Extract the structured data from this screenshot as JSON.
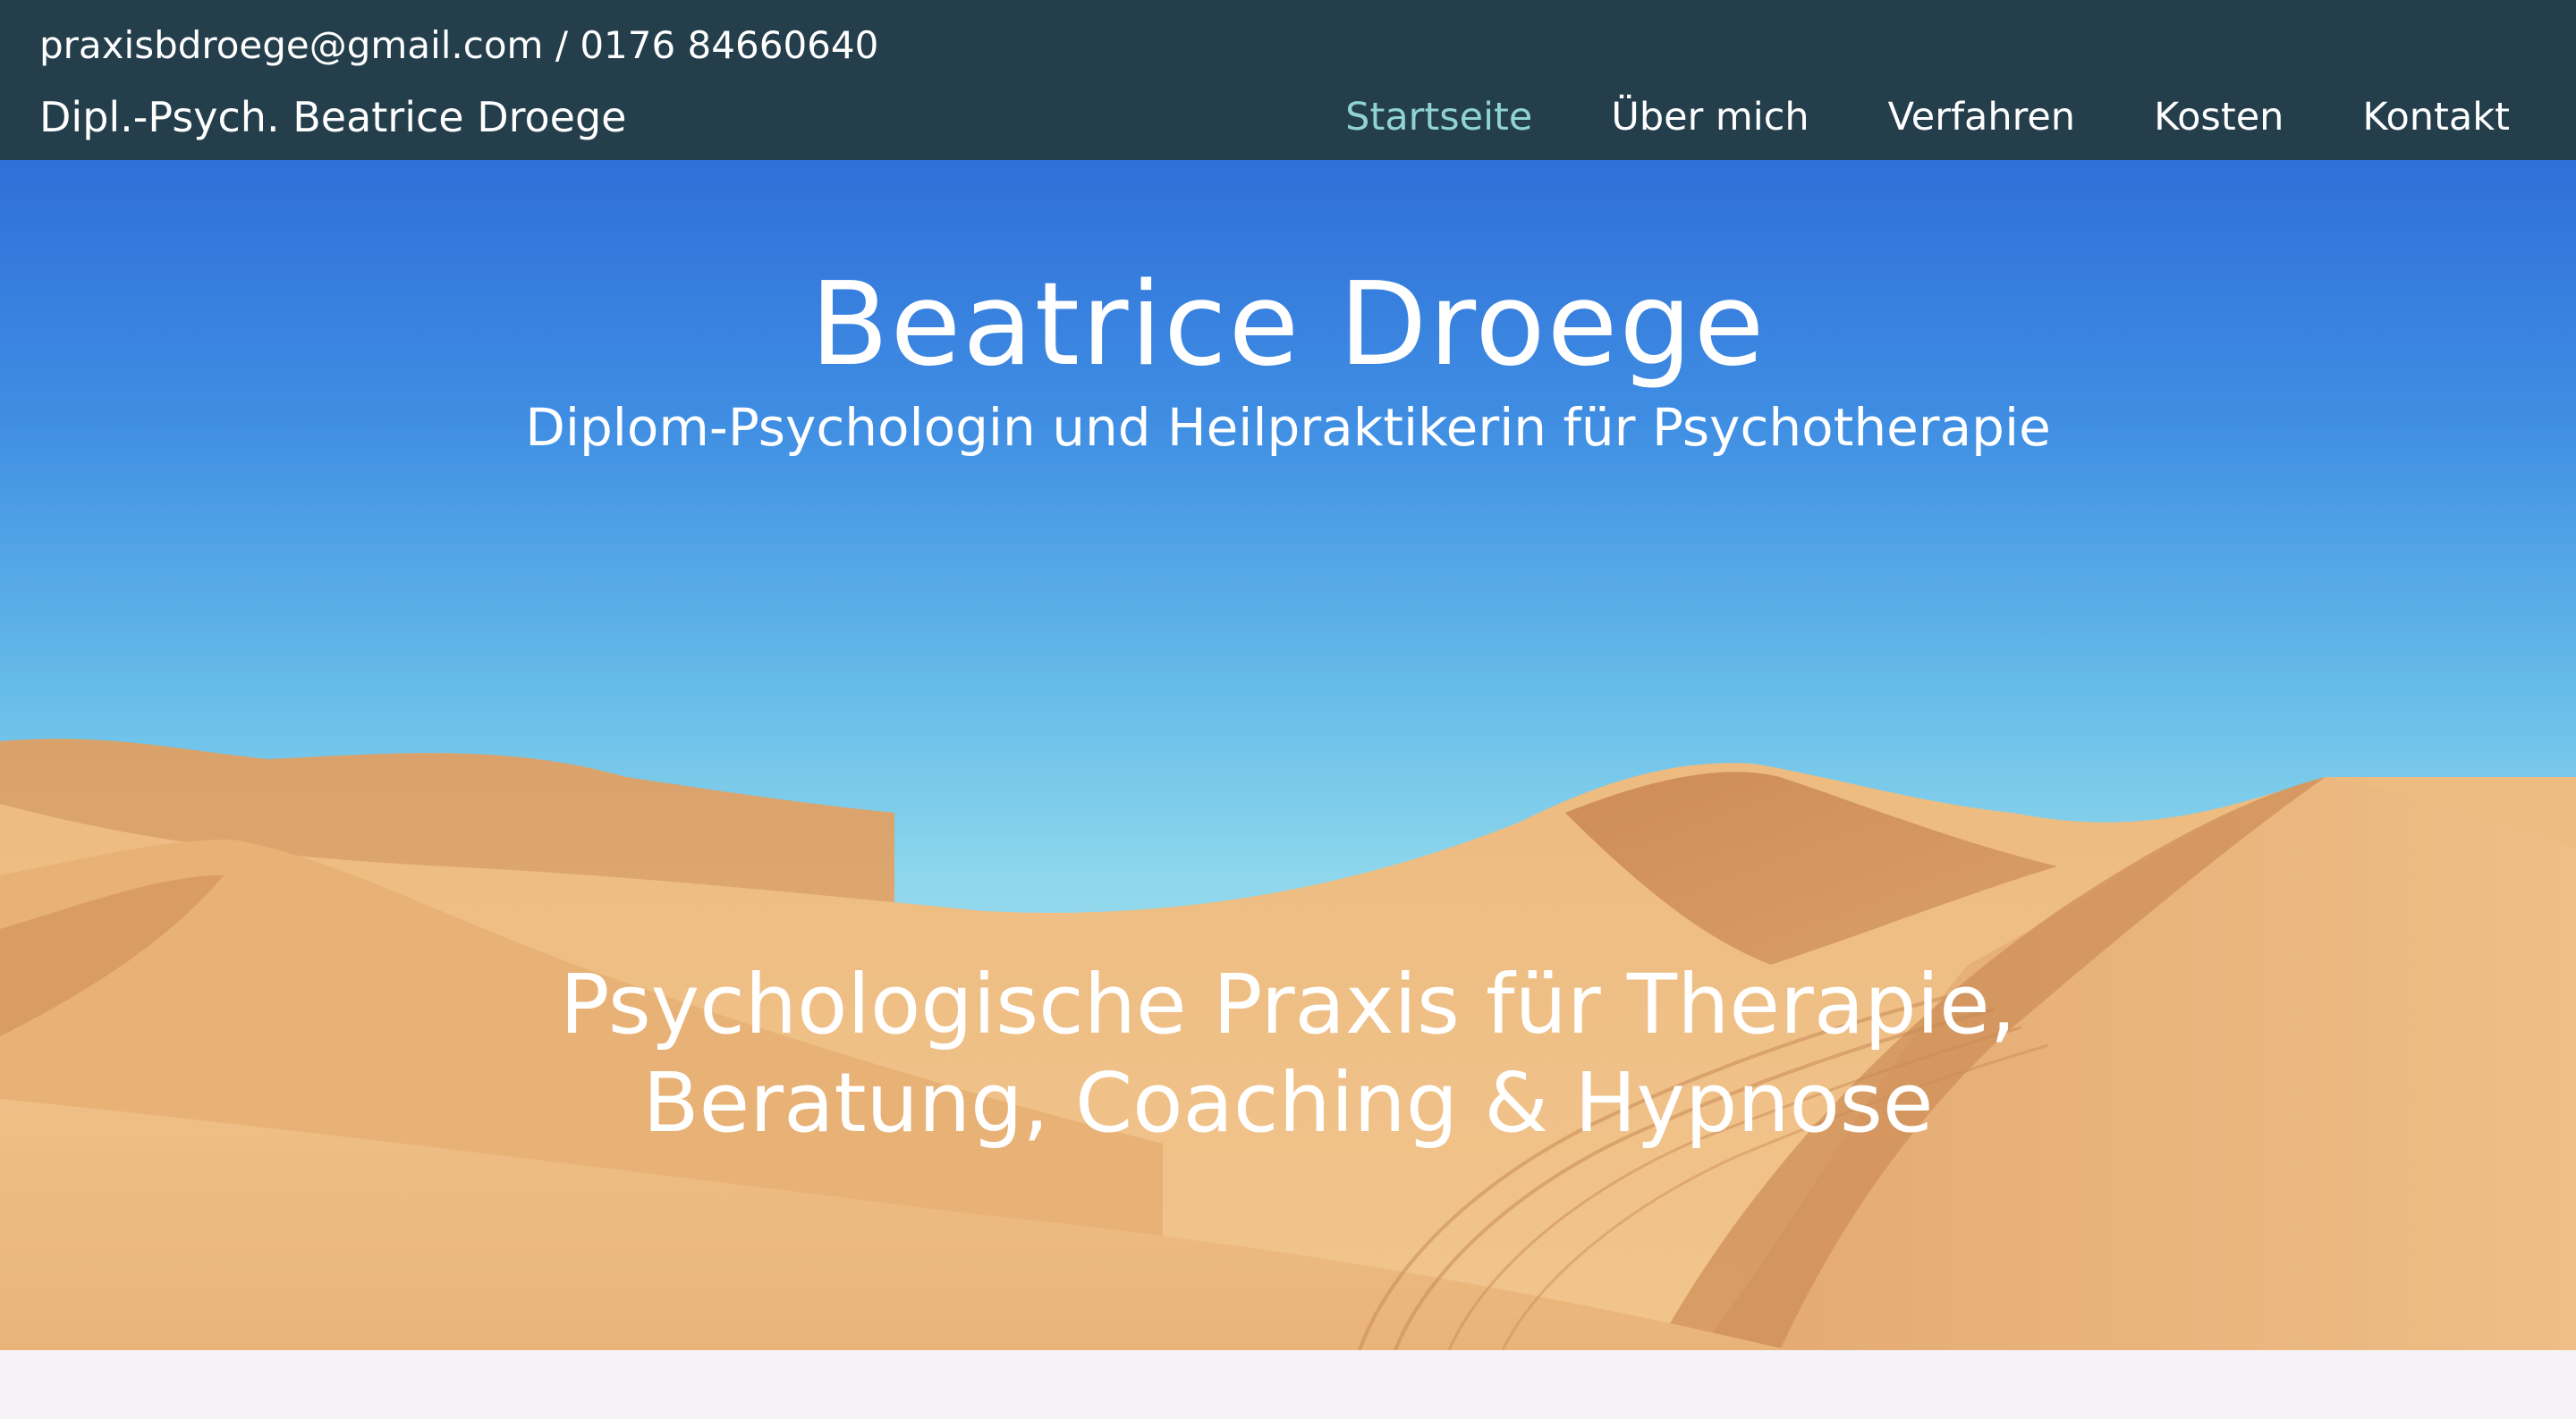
{
  "header": {
    "contact": "praxisbdroege@gmail.com / 0176 84660640",
    "site_title": "Dipl.-Psych. Beatrice Droege",
    "nav": [
      {
        "label": "Startseite",
        "active": true
      },
      {
        "label": "Über mich",
        "active": false
      },
      {
        "label": "Verfahren",
        "active": false
      },
      {
        "label": "Kosten",
        "active": false
      },
      {
        "label": "Kontakt",
        "active": false
      }
    ],
    "colors": {
      "background": "#243f4b",
      "text": "#ffffff",
      "active_nav": "#8fd3d6"
    }
  },
  "hero": {
    "title": "Beatrice Droege",
    "subtitle": "Diplom-Psychologin und Heilpraktikerin für Psychotherapie",
    "tagline_line1": "Psychologische Praxis für Therapie,",
    "tagline_line2": "Beratung, Coaching & Hypnose",
    "background_image": "desert-dunes-under-blue-sky"
  }
}
